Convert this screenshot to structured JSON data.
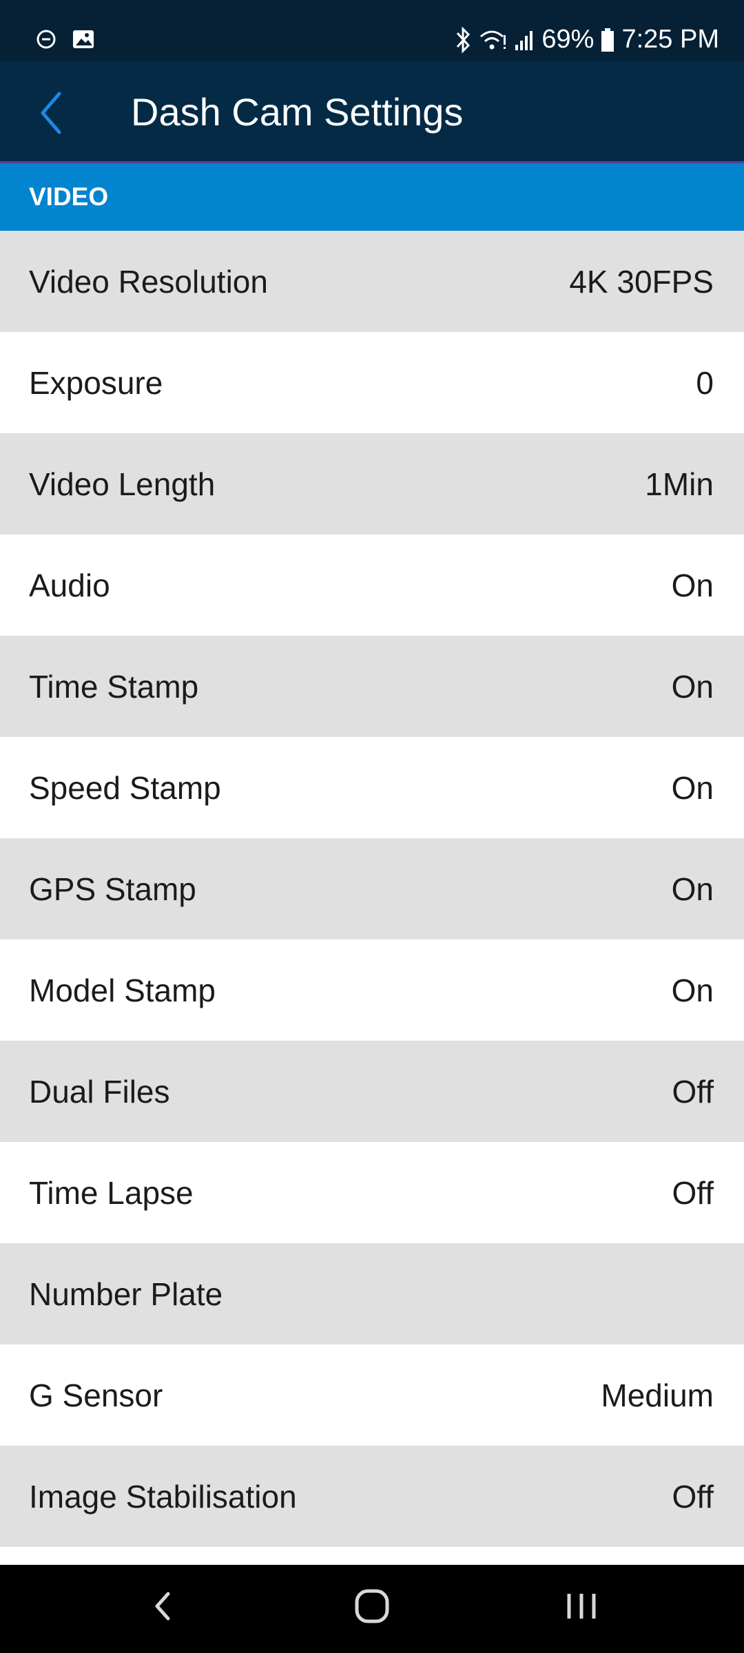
{
  "status_bar": {
    "battery": "69%",
    "time": "7:25 PM",
    "icons": [
      "do-not-disturb-icon",
      "image-icon",
      "bluetooth-icon",
      "wifi-icon",
      "signal-icon",
      "battery-icon"
    ]
  },
  "app_bar": {
    "title": "Dash Cam Settings",
    "back_icon": "chevron-left-icon"
  },
  "section": {
    "title": "VIDEO"
  },
  "settings": [
    {
      "label": "Video Resolution",
      "value": "4K 30FPS"
    },
    {
      "label": "Exposure",
      "value": "0"
    },
    {
      "label": "Video Length",
      "value": "1Min"
    },
    {
      "label": "Audio",
      "value": "On"
    },
    {
      "label": "Time Stamp",
      "value": "On"
    },
    {
      "label": "Speed Stamp",
      "value": "On"
    },
    {
      "label": "GPS Stamp",
      "value": "On"
    },
    {
      "label": "Model Stamp",
      "value": "On"
    },
    {
      "label": "Dual Files",
      "value": "Off"
    },
    {
      "label": "Time Lapse",
      "value": "Off"
    },
    {
      "label": "Number Plate",
      "value": ""
    },
    {
      "label": "G Sensor",
      "value": "Medium"
    },
    {
      "label": "Image Stabilisation",
      "value": "Off"
    },
    {
      "label": "",
      "value": ""
    }
  ],
  "nav_bar": {
    "buttons": [
      "back-nav-icon",
      "home-nav-icon",
      "recents-nav-icon"
    ]
  },
  "colors": {
    "status_bar": "#062136",
    "app_bar": "#042A45",
    "section_header": "#0284CF",
    "row_alt": "#E0E0E0",
    "row": "#FFFFFF",
    "back_icon": "#1E88E5"
  }
}
